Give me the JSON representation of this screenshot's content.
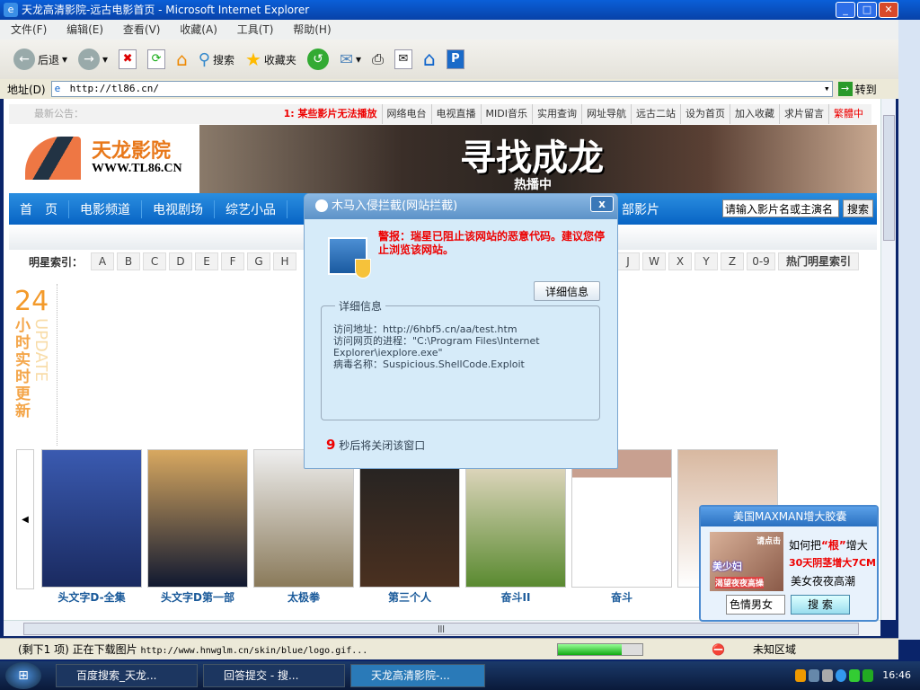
{
  "window": {
    "title": "天龙高清影院-远古电影首页 - Microsoft Internet Explorer"
  },
  "menu": [
    "文件(F)",
    "编辑(E)",
    "查看(V)",
    "收藏(A)",
    "工具(T)",
    "帮助(H)"
  ],
  "toolbar": {
    "back": "后退",
    "search": "搜索",
    "favorites": "收藏夹"
  },
  "address": {
    "label": "地址(D)",
    "url": "http://tl86.cn/",
    "go": "转到"
  },
  "site": {
    "notice_label": "最新公告：",
    "notice_text": "1: 某些影片无法播放",
    "top_links": [
      "网络电台",
      "电视直播",
      "MIDI音乐",
      "实用查询",
      "网址导航",
      "远古二站",
      "设为首页",
      "加入收藏",
      "求片留言",
      "繁體中"
    ],
    "logo_cn": "天龙影院",
    "logo_en": "WWW.TL86.CN",
    "banner_title": "寻找成龙",
    "banner_sub": "热播中",
    "nav": [
      "首　页",
      "电影频道",
      "电视剧场",
      "综艺小品",
      "部影片"
    ],
    "search_placeholder": "请输入影片名或主演名",
    "search_btn": "搜索",
    "star_index_label": "明星索引：",
    "star_keys_left": [
      "A",
      "B",
      "C",
      "D",
      "E",
      "F",
      "G",
      "H"
    ],
    "star_keys_right": [
      "J",
      "W",
      "X",
      "Y",
      "Z",
      "0-9"
    ],
    "hot_stars": "热门明星索引",
    "update_num": "24",
    "update_cn": "小时实时更新",
    "update_en": "UPDATE",
    "posters": [
      "头文字D-全集",
      "头文字D第一部",
      "太极拳",
      "第三个人",
      "奋斗II",
      "奋斗"
    ]
  },
  "dialog": {
    "title": "木马入侵拦截(网站拦截)",
    "warning": "警报：瑞星已阻止该网站的恶意代码。建议您停止浏览该网站。",
    "details_button": "详细信息",
    "details_legend": "详细信息",
    "visit_url": "访问地址：http://6hbf5.cn/aa/test.htm",
    "process": "访问网页的进程：\"C:\\Program Files\\Internet Explorer\\iexplore.exe\"",
    "virus": "病毒名称：Suspicious.ShellCode.Exploit",
    "countdown": "9",
    "countdown_text": "秒后将关闭该窗口"
  },
  "ad": {
    "title": "美国MAXMAN增大胶囊",
    "img_top": "请点击",
    "img_mid": "美少妇",
    "img_bot": "渴望夜夜高操",
    "line1a": "如何把",
    "line1b": "“根”",
    "line1c": "增大",
    "line2": "30天阴茎增大7CM",
    "line3": "美女夜夜高潮",
    "input": "色情男女",
    "button": "搜 索"
  },
  "status": {
    "message": "(剩下1 项) 正在下载图片",
    "url": "http://www.hnwglm.cn/skin/blue/logo.gif...",
    "progress_pct": 75,
    "zone": "未知区域"
  },
  "taskbar": {
    "tasks": [
      "百度搜索_天龙...",
      "回答提交 - 搜...",
      "天龙高清影院-..."
    ],
    "active": 2,
    "clock": "16:46"
  }
}
